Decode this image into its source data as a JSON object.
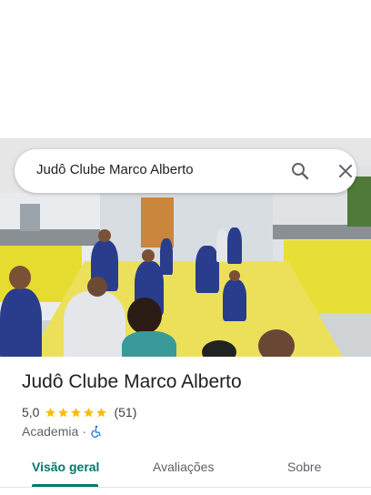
{
  "search": {
    "query": "Judô Clube Marco Alberto"
  },
  "place": {
    "name": "Judô Clube Marco Alberto",
    "rating": "5,0",
    "stars": 5,
    "review_count": "(51)",
    "category": "Academia",
    "separator": "·"
  },
  "tabs": [
    {
      "label": "Visão geral",
      "active": true
    },
    {
      "label": "Avaliações",
      "active": false
    },
    {
      "label": "Sobre",
      "active": false
    }
  ],
  "colors": {
    "accent": "#00796b",
    "star": "#fbbc04",
    "wheelchair": "#1a73e8"
  },
  "icons": {
    "search": "search-icon",
    "close": "close-icon",
    "accessibility": "wheelchair-icon",
    "star": "star-icon"
  }
}
